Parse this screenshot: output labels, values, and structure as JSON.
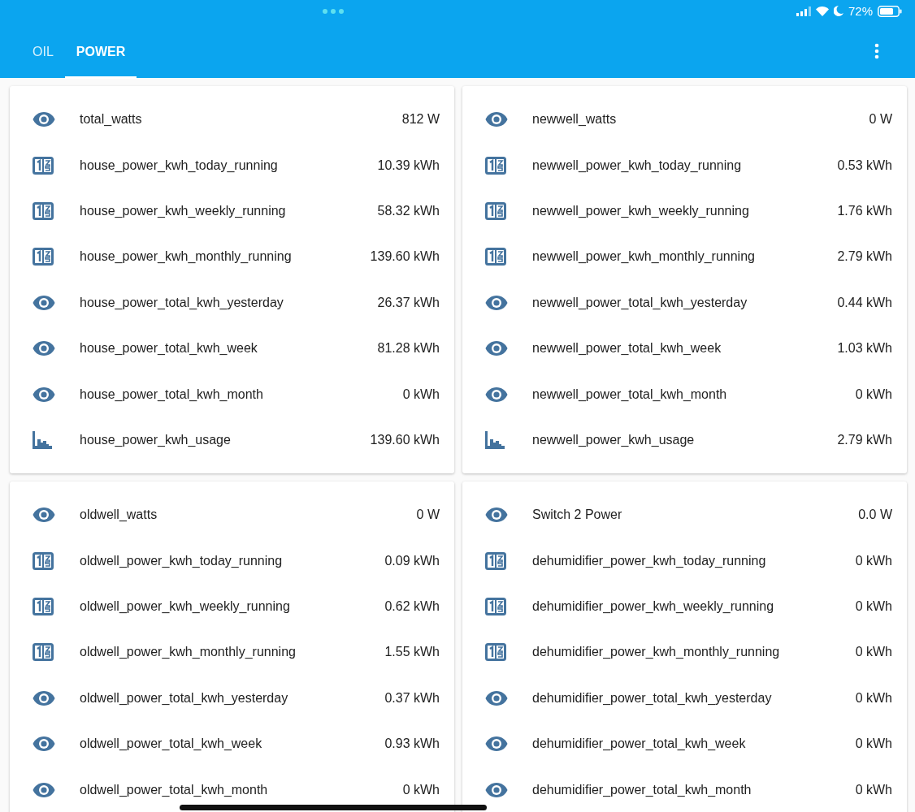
{
  "status_bar": {
    "battery": "72%"
  },
  "tabs": [
    {
      "label": "OIL",
      "selected": false
    },
    {
      "label": "POWER",
      "selected": true
    }
  ],
  "cards": [
    {
      "rows": [
        {
          "kind": "eye",
          "name": "total_watts",
          "value": "812 W"
        },
        {
          "kind": "counter",
          "name": "house_power_kwh_today_running",
          "value": "10.39 kWh"
        },
        {
          "kind": "counter",
          "name": "house_power_kwh_weekly_running",
          "value": "58.32 kWh"
        },
        {
          "kind": "counter",
          "name": "house_power_kwh_monthly_running",
          "value": "139.60 kWh"
        },
        {
          "kind": "eye",
          "name": "house_power_total_kwh_yesterday",
          "value": "26.37 kWh"
        },
        {
          "kind": "eye",
          "name": "house_power_total_kwh_week",
          "value": "81.28 kWh"
        },
        {
          "kind": "eye",
          "name": "house_power_total_kwh_month",
          "value": "0 kWh"
        },
        {
          "kind": "chart",
          "name": "house_power_kwh_usage",
          "value": "139.60 kWh"
        }
      ]
    },
    {
      "rows": [
        {
          "kind": "eye",
          "name": "newwell_watts",
          "value": "0 W"
        },
        {
          "kind": "counter",
          "name": "newwell_power_kwh_today_running",
          "value": "0.53 kWh"
        },
        {
          "kind": "counter",
          "name": "newwell_power_kwh_weekly_running",
          "value": "1.76 kWh"
        },
        {
          "kind": "counter",
          "name": "newwell_power_kwh_monthly_running",
          "value": "2.79 kWh"
        },
        {
          "kind": "eye",
          "name": "newwell_power_total_kwh_yesterday",
          "value": "0.44 kWh"
        },
        {
          "kind": "eye",
          "name": "newwell_power_total_kwh_week",
          "value": "1.03 kWh"
        },
        {
          "kind": "eye",
          "name": "newwell_power_total_kwh_month",
          "value": "0 kWh"
        },
        {
          "kind": "chart",
          "name": "newwell_power_kwh_usage",
          "value": "2.79 kWh"
        }
      ]
    },
    {
      "rows": [
        {
          "kind": "eye",
          "name": "oldwell_watts",
          "value": "0 W"
        },
        {
          "kind": "counter",
          "name": "oldwell_power_kwh_today_running",
          "value": "0.09 kWh"
        },
        {
          "kind": "counter",
          "name": "oldwell_power_kwh_weekly_running",
          "value": "0.62 kWh"
        },
        {
          "kind": "counter",
          "name": "oldwell_power_kwh_monthly_running",
          "value": "1.55 kWh"
        },
        {
          "kind": "eye",
          "name": "oldwell_power_total_kwh_yesterday",
          "value": "0.37 kWh"
        },
        {
          "kind": "eye",
          "name": "oldwell_power_total_kwh_week",
          "value": "0.93 kWh"
        },
        {
          "kind": "eye",
          "name": "oldwell_power_total_kwh_month",
          "value": "0 kWh"
        }
      ]
    },
    {
      "rows": [
        {
          "kind": "eye",
          "name": "Switch 2 Power",
          "value": "0.0 W"
        },
        {
          "kind": "counter",
          "name": "dehumidifier_power_kwh_today_running",
          "value": "0 kWh"
        },
        {
          "kind": "counter",
          "name": "dehumidifier_power_kwh_weekly_running",
          "value": "0 kWh"
        },
        {
          "kind": "counter",
          "name": "dehumidifier_power_kwh_monthly_running",
          "value": "0 kWh"
        },
        {
          "kind": "eye",
          "name": "dehumidifier_power_total_kwh_yesterday",
          "value": "0 kWh"
        },
        {
          "kind": "eye",
          "name": "dehumidifier_power_total_kwh_week",
          "value": "0 kWh"
        },
        {
          "kind": "eye",
          "name": "dehumidifier_power_total_kwh_month",
          "value": "0 kWh"
        }
      ]
    }
  ]
}
